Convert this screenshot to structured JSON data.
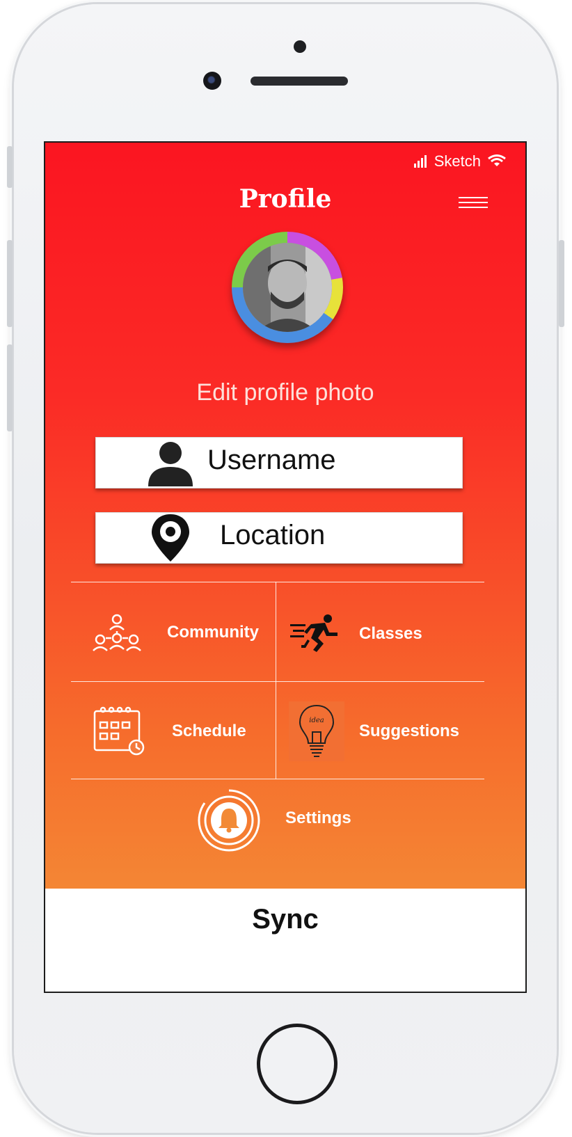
{
  "status_bar": {
    "carrier": "Sketch"
  },
  "header": {
    "title": "Profile"
  },
  "profile": {
    "edit_photo_label": "Edit profile photo"
  },
  "fields": {
    "username_label": "Username",
    "location_label": "Location"
  },
  "menu_grid": {
    "community": "Community",
    "classes": "Classes",
    "schedule": "Schedule",
    "suggestions": "Suggestions",
    "settings": "Settings"
  },
  "footer": {
    "sync_label": "Sync"
  },
  "icon_names": {
    "signal": "signal-icon",
    "wifi": "wifi-icon",
    "menu": "hamburger-menu-icon",
    "user": "user-icon",
    "location": "map-pin-icon",
    "community": "community-icon",
    "classes": "running-icon",
    "schedule": "calendar-icon",
    "suggestions": "lightbulb-icon",
    "settings": "bell-icon"
  },
  "colors": {
    "gradient_top": "#fb1521",
    "gradient_bottom": "#f3973a"
  }
}
